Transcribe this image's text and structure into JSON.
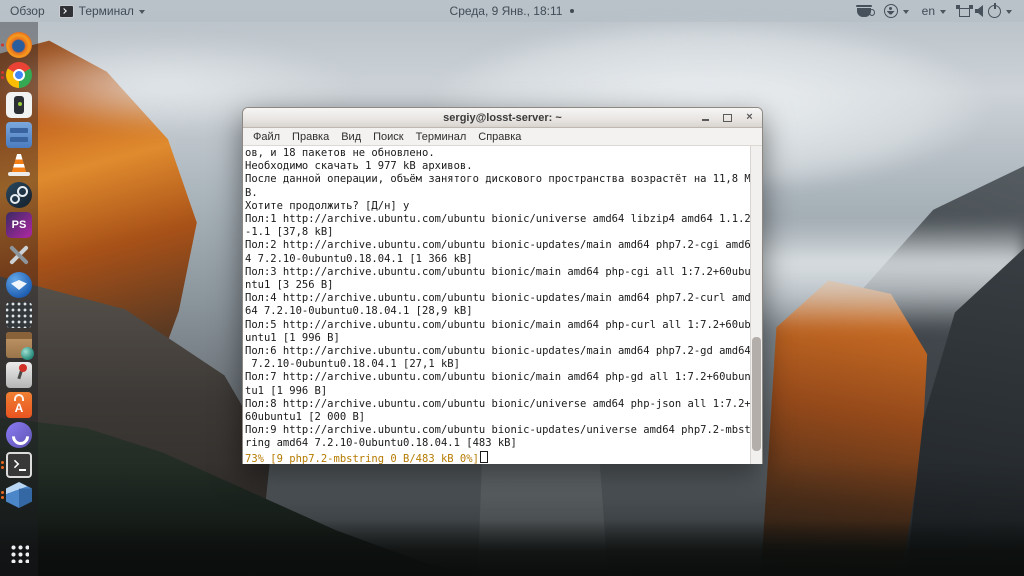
{
  "top_bar": {
    "activities": "Обзор",
    "focused_app": "Терминал",
    "clock": "Среда, 9 Янв., 18:11",
    "keyboard_layout": "en"
  },
  "dock": {
    "items": [
      {
        "name": "firefox",
        "running_dots": 1
      },
      {
        "name": "chrome",
        "running_dots": 2
      },
      {
        "name": "phone-app",
        "running_dots": 0
      },
      {
        "name": "file-cabinet",
        "running_dots": 0
      },
      {
        "name": "vlc",
        "running_dots": 0
      },
      {
        "name": "steam",
        "running_dots": 0
      },
      {
        "name": "ps-editor",
        "label": "PS",
        "running_dots": 0
      },
      {
        "name": "tweak-tools",
        "running_dots": 0
      },
      {
        "name": "thunderbird",
        "running_dots": 0
      },
      {
        "name": "calculator",
        "running_dots": 0
      },
      {
        "name": "software-box",
        "running_dots": 0
      },
      {
        "name": "lever-app",
        "running_dots": 0
      },
      {
        "name": "app-store-bag",
        "label": "A",
        "running_dots": 0
      },
      {
        "name": "viber",
        "running_dots": 0
      },
      {
        "name": "terminal",
        "running_dots": 2
      },
      {
        "name": "virtualbox",
        "running_dots": 2
      },
      {
        "name": "show-applications"
      }
    ]
  },
  "terminal": {
    "title": "sergiy@losst-server: ~",
    "close_glyph": "×",
    "menu": [
      "Файл",
      "Правка",
      "Вид",
      "Поиск",
      "Терминал",
      "Справка"
    ],
    "lines": [
      "ов, и 18 пакетов не обновлено.",
      "Необходимо скачать 1 977 kB архивов.",
      "После данной операции, объём занятого дискового пространства возрастёт на 11,8 M",
      "B.",
      "Хотите продолжить? [Д/н] y",
      "Пол:1 http://archive.ubuntu.com/ubuntu bionic/universe amd64 libzip4 amd64 1.1.2",
      "-1.1 [37,8 kB]",
      "Пол:2 http://archive.ubuntu.com/ubuntu bionic-updates/main amd64 php7.2-cgi amd6",
      "4 7.2.10-0ubuntu0.18.04.1 [1 366 kB]",
      "Пол:3 http://archive.ubuntu.com/ubuntu bionic/main amd64 php-cgi all 1:7.2+60ubu",
      "ntu1 [3 256 B]",
      "Пол:4 http://archive.ubuntu.com/ubuntu bionic-updates/main amd64 php7.2-curl amd",
      "64 7.2.10-0ubuntu0.18.04.1 [28,9 kB]",
      "Пол:5 http://archive.ubuntu.com/ubuntu bionic/main amd64 php-curl all 1:7.2+60ub",
      "untu1 [1 996 B]",
      "Пол:6 http://archive.ubuntu.com/ubuntu bionic-updates/main amd64 php7.2-gd amd64",
      " 7.2.10-0ubuntu0.18.04.1 [27,1 kB]",
      "Пол:7 http://archive.ubuntu.com/ubuntu bionic/main amd64 php-gd all 1:7.2+60ubun",
      "tu1 [1 996 B]",
      "Пол:8 http://archive.ubuntu.com/ubuntu bionic/universe amd64 php-json all 1:7.2+",
      "60ubuntu1 [2 000 B]",
      "Пол:9 http://archive.ubuntu.com/ubuntu bionic-updates/universe amd64 php7.2-mbst",
      "ring amd64 7.2.10-0ubuntu0.18.04.1 [483 kB]"
    ],
    "progress_line": "73% [9 php7.2-mbstring 0 B/483 kB 0%]",
    "colors": {
      "progress_text": "#b57b00",
      "background": "#ffffff",
      "text": "#1a1a1a"
    }
  }
}
